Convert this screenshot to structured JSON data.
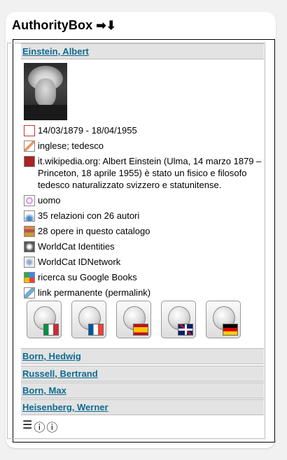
{
  "widget": {
    "title": "AuthorityBox",
    "title_arrows": "➡⬇"
  },
  "authors": [
    {
      "name": "Einstein, Albert"
    },
    {
      "name": "Born, Hedwig"
    },
    {
      "name": "Russell, Bertrand"
    },
    {
      "name": "Born, Max"
    },
    {
      "name": "Heisenberg, Werner"
    }
  ],
  "details": {
    "dates": "14/03/1879 - 18/04/1955",
    "languages": "inglese; tedesco",
    "wiki_text": "it.wikipedia.org: Albert Einstein (Ulma, 14 marzo 1879 – Princeton, 18 aprile 1955) è stato un fisico e filosofo tedesco naturalizzato svizzero e statunitense.",
    "gender": "uomo",
    "relations": "35 relazioni con 26 autori",
    "works": "28 opere in questo catalogo",
    "worldcat_identities": "WorldCat Identities",
    "worldcat_idnetwork": "WorldCat IDNetwork",
    "google_books": "ricerca su Google Books",
    "permalink": "link permanente (permalink)"
  },
  "icons": {
    "dates": "calendar-icon",
    "languages": "pencil-icon",
    "wiki": "wikipedia-icon",
    "gender": "person-icon",
    "relations": "network-icon",
    "works": "books-icon",
    "worldcat_identities": "worldcat-icon",
    "worldcat_idnetwork": "worldcat-network-icon",
    "google_books": "google-books-icon",
    "permalink": "link-icon"
  },
  "wikipedia_links": [
    {
      "lang": "it",
      "flag": "italy-flag-icon"
    },
    {
      "lang": "fr",
      "flag": "france-flag-icon"
    },
    {
      "lang": "es",
      "flag": "spain-flag-icon"
    },
    {
      "lang": "en",
      "flag": "uk-flag-icon"
    },
    {
      "lang": "de",
      "flag": "germany-flag-icon"
    }
  ],
  "footer_icons": [
    "settings-sliders-icon",
    "help-icon",
    "info-icon"
  ],
  "colors": {
    "link": "#0e6a91",
    "row_bg": "#e3e3e3"
  }
}
